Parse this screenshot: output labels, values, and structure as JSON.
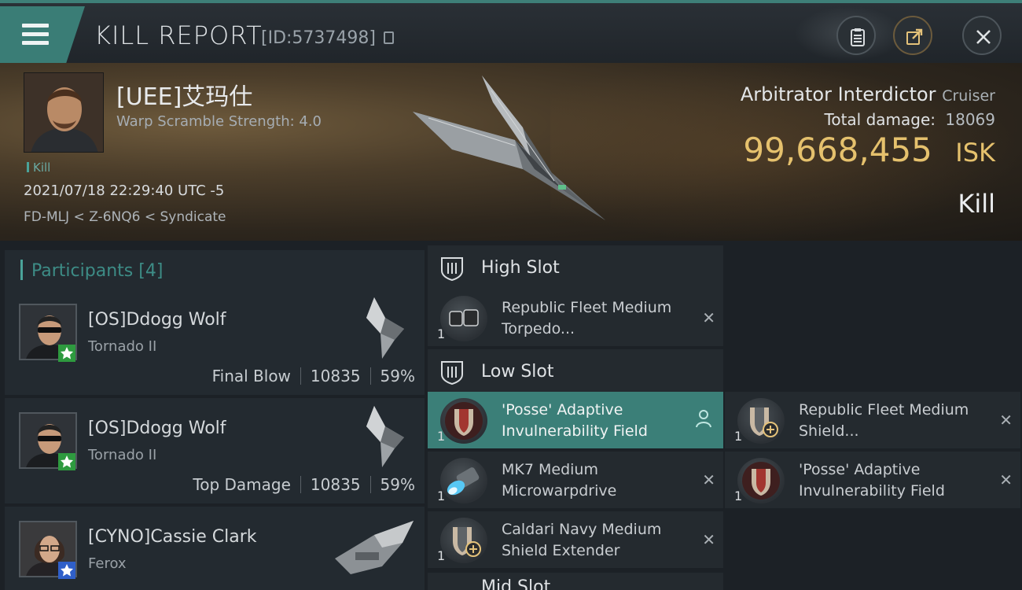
{
  "header": {
    "title": "KILL REPORT",
    "report_id": "[ID:5737498]",
    "icons": [
      "menu-icon",
      "copy-icon",
      "clipboard-icon",
      "share-icon",
      "close-icon"
    ]
  },
  "victim": {
    "name": "[UEE]艾玛仕",
    "warp_scramble": "Warp Scramble Strength: 4.0",
    "tag": "Kill",
    "datetime": "2021/07/18 22:29:40 UTC -5",
    "location": "FD-MLJ < Z-6NQ6 < Syndicate",
    "ship": "Arbitrator Interdictor",
    "ship_class": "Cruiser",
    "total_damage_label": "Total damage:",
    "total_damage": "18069",
    "isk_value": "99,668,455",
    "isk_unit": "ISK",
    "result": "Kill"
  },
  "participants": {
    "label": "Participants",
    "count": "[4]",
    "items": [
      {
        "name": "[OS]Ddogg Wolf",
        "ship": "Tornado II",
        "role": "Final Blow",
        "damage": "10835",
        "percent": "59%",
        "badge_color": "#2e9a3f"
      },
      {
        "name": "[OS]Ddogg Wolf",
        "ship": "Tornado II",
        "role": "Top Damage",
        "damage": "10835",
        "percent": "59%",
        "badge_color": "#2e9a3f"
      },
      {
        "name": "[CYNO]Cassie Clark",
        "ship": "Ferox",
        "badge_color": "#2f5fc9"
      }
    ]
  },
  "fitting": {
    "high_slot": {
      "label": "High Slot",
      "modules": [
        {
          "name": "Republic Fleet Medium Torpedo...",
          "qty": "1"
        }
      ]
    },
    "low_slot": {
      "label": "Low Slot",
      "modules": [
        {
          "name": "'Posse' Adaptive Invulnerability Field",
          "qty": "1"
        },
        {
          "name": "MK7 Medium Microwarpdrive",
          "qty": "1"
        },
        {
          "name": "Caldari Navy Medium Shield Extender",
          "qty": "1"
        },
        {
          "name": "Republic Fleet Medium Shield...",
          "qty": "1"
        },
        {
          "name": "'Posse' Adaptive Invulnerability Field",
          "qty": "1"
        }
      ]
    },
    "next_slot_partial": "Mid Slot"
  },
  "colors": {
    "accent": "#3b7f78",
    "isk": "#e5c16d",
    "background": "#1c2126"
  }
}
